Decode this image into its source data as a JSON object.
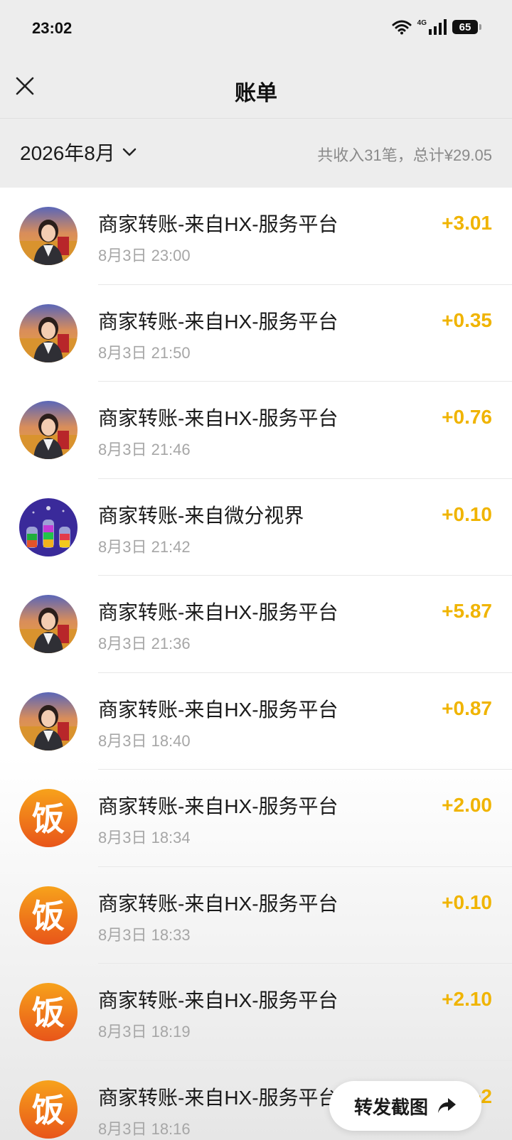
{
  "status_bar": {
    "time": "23:02",
    "battery": "65",
    "network": "4G"
  },
  "nav": {
    "title": "账单",
    "close_icon": "close-icon"
  },
  "filter": {
    "month": "2026年8月",
    "summary": "共收入31笔，总计¥29.05"
  },
  "transactions": [
    {
      "title": "商家转账-来自HX-服务平台",
      "time": "8月3日 23:00",
      "amount": "+3.01",
      "avatar": "woman-avatar"
    },
    {
      "title": "商家转账-来自HX-服务平台",
      "time": "8月3日 21:50",
      "amount": "+0.35",
      "avatar": "woman-avatar"
    },
    {
      "title": "商家转账-来自HX-服务平台",
      "time": "8月3日 21:46",
      "amount": "+0.76",
      "avatar": "woman-avatar"
    },
    {
      "title": "商家转账-来自微分视界",
      "time": "8月3日 21:42",
      "amount": "+0.10",
      "avatar": "bottles-avatar"
    },
    {
      "title": "商家转账-来自HX-服务平台",
      "time": "8月3日 21:36",
      "amount": "+5.87",
      "avatar": "woman-avatar"
    },
    {
      "title": "商家转账-来自HX-服务平台",
      "time": "8月3日 18:40",
      "amount": "+0.87",
      "avatar": "woman-avatar"
    },
    {
      "title": "商家转账-来自HX-服务平台",
      "time": "8月3日 18:34",
      "amount": "+2.00",
      "avatar": "fan-avatar"
    },
    {
      "title": "商家转账-来自HX-服务平台",
      "time": "8月3日 18:33",
      "amount": "+0.10",
      "avatar": "fan-avatar"
    },
    {
      "title": "商家转账-来自HX-服务平台",
      "time": "8月3日 18:19",
      "amount": "+2.10",
      "avatar": "fan-avatar"
    },
    {
      "title": "商家转账-来自HX-服务平台",
      "time": "8月3日 18:16",
      "amount": "+2",
      "avatar": "fan-avatar"
    }
  ],
  "fan_avatar_char": "饭",
  "forward": {
    "label": "转发截图",
    "icon": "share-arrow-icon"
  },
  "colors": {
    "amount": "#f0b400",
    "background": "#ededed",
    "time_text": "#a6a6a6"
  }
}
